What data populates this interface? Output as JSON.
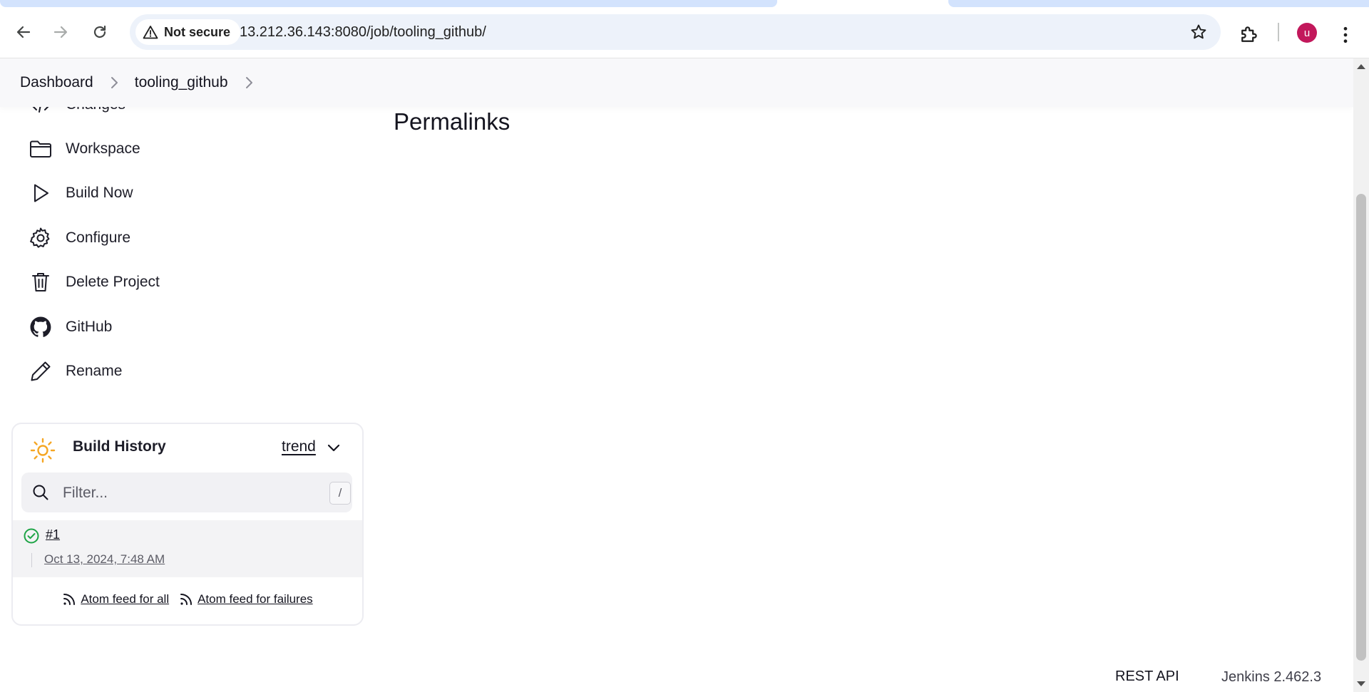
{
  "browser": {
    "security_label": "Not secure",
    "url": "13.212.36.143:8080/job/tooling_github/",
    "avatar_initial": "u"
  },
  "breadcrumb": {
    "items": [
      "Dashboard",
      "tooling_github"
    ]
  },
  "sidebar": {
    "items": [
      {
        "label": "Changes",
        "icon": "code-icon"
      },
      {
        "label": "Workspace",
        "icon": "folder-icon"
      },
      {
        "label": "Build Now",
        "icon": "play-icon"
      },
      {
        "label": "Configure",
        "icon": "gear-icon"
      },
      {
        "label": "Delete Project",
        "icon": "trash-icon"
      },
      {
        "label": "GitHub",
        "icon": "github-icon"
      },
      {
        "label": "Rename",
        "icon": "pencil-icon"
      }
    ]
  },
  "main": {
    "heading": "Permalinks"
  },
  "build_history": {
    "title": "Build History",
    "trend_label": "trend",
    "filter_placeholder": "Filter...",
    "shortcut_key": "/",
    "builds": [
      {
        "number": "#1",
        "date": "Oct 13, 2024, 7:48 AM",
        "status": "success",
        "status_color": "#1ea446"
      }
    ],
    "feed_all": "Atom feed for all",
    "feed_failures": "Atom feed for failures"
  },
  "footer": {
    "rest_api": "REST API",
    "version": "Jenkins 2.462.3"
  },
  "colors": {
    "sun": "#f5a623",
    "avatar_bg": "#c2185b",
    "success": "#1ea446"
  }
}
